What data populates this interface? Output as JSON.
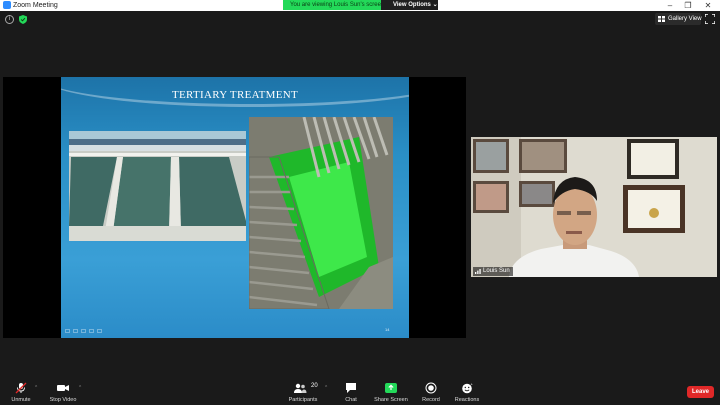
{
  "window": {
    "title": "Zoom Meeting"
  },
  "banner": {
    "message": "You are viewing Louis Sun's screen",
    "view_options": "View Options ⌄"
  },
  "top": {
    "gallery_view": "Gallery View"
  },
  "slide": {
    "title": "TERTIARY TREATMENT",
    "page_number": "14"
  },
  "video": {
    "participant_name": "Louis Sun"
  },
  "toolbar": {
    "unmute": "Unmute",
    "stop_video": "Stop Video",
    "participants": "Participants",
    "participants_count": "20",
    "chat": "Chat",
    "share_screen": "Share Screen",
    "record": "Record",
    "reactions": "Reactions",
    "leave": "Leave"
  },
  "colors": {
    "share_banner": "#23d959",
    "share_screen_icon": "#23d959",
    "leave": "#e02828",
    "accent": "#2d8cff"
  }
}
